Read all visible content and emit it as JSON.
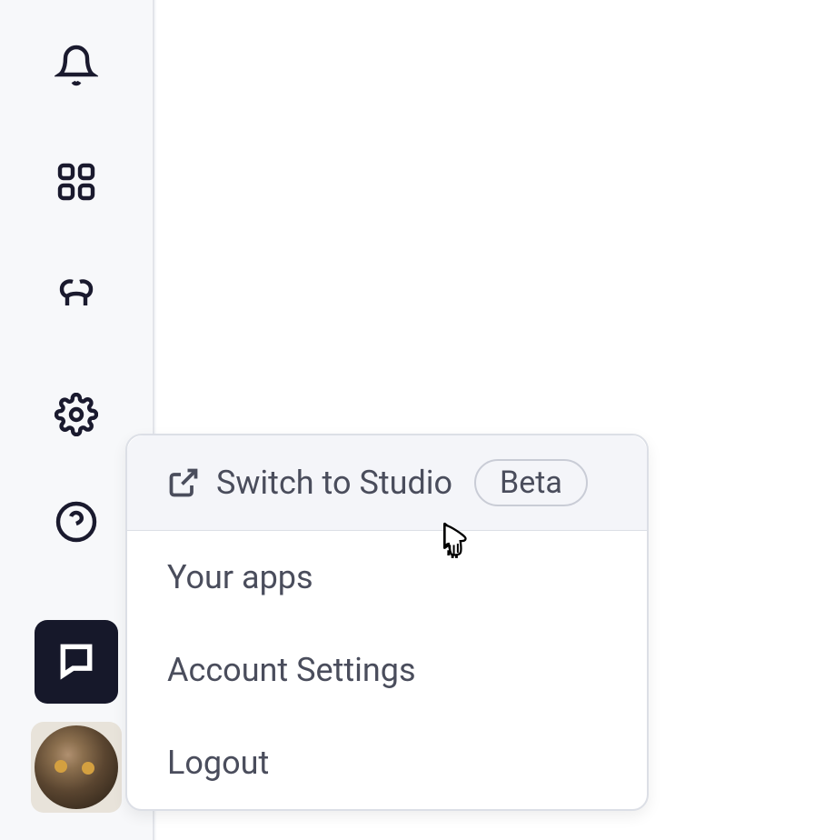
{
  "sidebar": {
    "icons": {
      "bell": "bell-icon",
      "apps": "apps-grid-icon",
      "webhook": "webhook-icon",
      "settings": "gear-icon",
      "help": "help-icon",
      "chat": "chat-icon"
    }
  },
  "menu": {
    "items": [
      {
        "label": "Switch to Studio",
        "badge": "Beta",
        "has_external_icon": true
      },
      {
        "label": "Your apps"
      },
      {
        "label": "Account Settings"
      },
      {
        "label": "Logout"
      }
    ]
  }
}
